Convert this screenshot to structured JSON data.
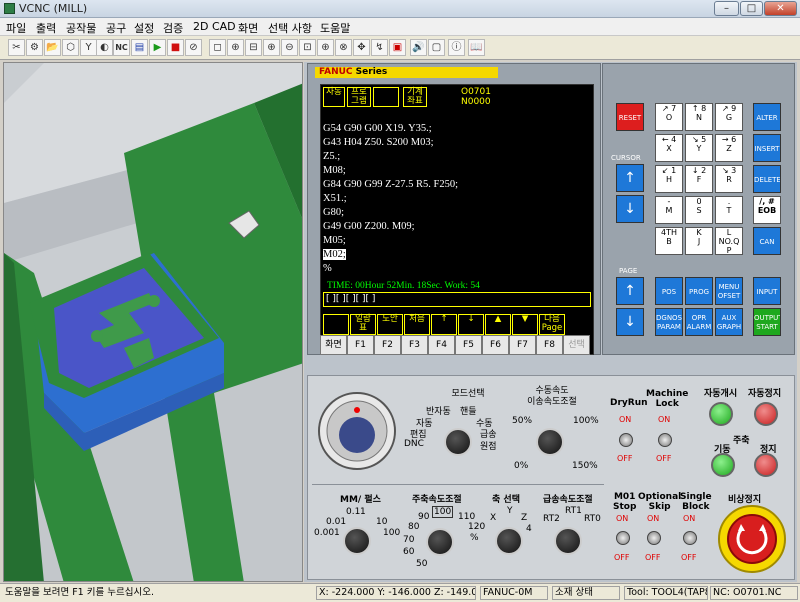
{
  "window": {
    "title": "VCNC (MILL)",
    "min": "–",
    "max": "□",
    "close": "✕"
  },
  "menu": [
    "파일",
    "출력",
    "공작물",
    "공구",
    "설정",
    "검증",
    "2D CAD",
    "화면",
    "선택 사항",
    "도움말"
  ],
  "toolbar": [
    "✂",
    "⚙",
    "📂",
    "⬡",
    "Y",
    "◐",
    "NC",
    "▤",
    "▶",
    "■",
    "⊘",
    "◻",
    "⊕",
    "⊟",
    "⊕",
    "⊖",
    "⊡",
    "⊕",
    "⊗",
    "✥",
    "↯",
    "▣",
    "🔊",
    "▢",
    "ⓘ",
    "📖"
  ],
  "crt": {
    "brand": "FANUC",
    "series": "Series",
    "mode_boxes": [
      "자동",
      "프로\n그램",
      "",
      "기계\n좌표"
    ],
    "program_no": "O0701",
    "seq_no": "N0000",
    "lines": [
      "G54 G90 G00 X19. Y35.;",
      "G43 H04 Z50. S200 M03;",
      "Z5.;",
      "M08;",
      "G84 G90 G99 Z-27.5 R5. F250;",
      "X51.;",
      "G80;",
      "G49 G00 Z200. M09;",
      "M05;",
      "M02;",
      "%"
    ],
    "selected_line": 9,
    "time": "TIME: 00Hour 52Min. 18Sec.  Work: 54",
    "buffer": "[  ][  ][  ][  ][  ]",
    "softkeys": [
      "",
      "일람\n표",
      "도안",
      "처음",
      "↑",
      "↓",
      "▲",
      "▼",
      "다음\nPage"
    ],
    "fkeys": [
      "화면",
      "F1",
      "F2",
      "F3",
      "F4",
      "F5",
      "F6",
      "F7",
      "F8",
      "선택"
    ]
  },
  "keypad": {
    "reset": "RESET",
    "cursor": "CURSOR",
    "page": "PAGE",
    "alter": "ALTER",
    "insert": "INSERT",
    "delete": "DELETE",
    "eob": "/, #\nEOB",
    "can": "CAN",
    "pos": "POS",
    "prog": "PROG",
    "menu": "MENU\nOFSET",
    "dgnos": "DGNOS\nPARAM",
    "opr": "OPR\nALARM",
    "aux": "AUX\nGRAPH",
    "input": "INPUT",
    "output": "OUTPUT\nSTART",
    "keys": [
      "↗ 7\nO",
      "↑ 8\nN",
      "↗ 9\nG",
      "← 4\nX",
      "↘ 5\nY",
      "→ 6\nZ",
      "↙ 1\nH",
      "↓ 2\nF",
      "↘ 3\nR",
      "-\nM",
      "0\nS",
      ".\nT",
      "4TH\nB",
      "K\nJ",
      "L\nNO.Q\nP"
    ]
  },
  "panel": {
    "mode_title": "모드선택",
    "mode_labels": [
      "반자동",
      "핸들",
      "자동",
      "수동",
      "편집",
      "급송",
      "DNC",
      "원점"
    ],
    "feed_title": "수동속도\n이송속도조절",
    "feed_labels": [
      "50%",
      "100%",
      "0%",
      "150%"
    ],
    "dryrun": "DryRun",
    "machlock": "Machine\nLock",
    "on": "ON",
    "off": "OFF",
    "cycle_start": "자동개시",
    "cycle_stop": "자동정지",
    "spindle": "주축",
    "spin_start": "기동",
    "spin_stop": "정지",
    "mm_title": "MM/ 펄스",
    "mm_labels": [
      "0.1",
      "1",
      "0.01",
      "10",
      "0.001",
      "100"
    ],
    "spindle_ovr": "주축속도조절",
    "spindle_vals": [
      "100",
      "90",
      "110",
      "80",
      "120",
      "70",
      "%",
      "60",
      "50"
    ],
    "axis_title": "축 선택",
    "axis_labels": [
      "X",
      "Y",
      "Z",
      "4"
    ],
    "rapid_title": "급송속도조절",
    "rapid_labels": [
      "RT1",
      "RT2",
      "RT0"
    ],
    "m01": "M01\nStop",
    "optskip": "Optional\nSkip",
    "single": "Single\nBlock",
    "estop": "비상정지"
  },
  "status": {
    "hint": "도움말을 보려면 F1 키를 누르십시오.",
    "coords": "X: -224.000  Y: -146.000  Z: -149.000",
    "control": "FANUC-0M",
    "stock": "소재 상태",
    "tool": "Tool: TOOL4(TAP8)",
    "nc": "NC: O0701.NC"
  },
  "colors": {
    "green": "#2e8b3d",
    "blue": "#4a55c8",
    "yellow": "#f5d800"
  }
}
